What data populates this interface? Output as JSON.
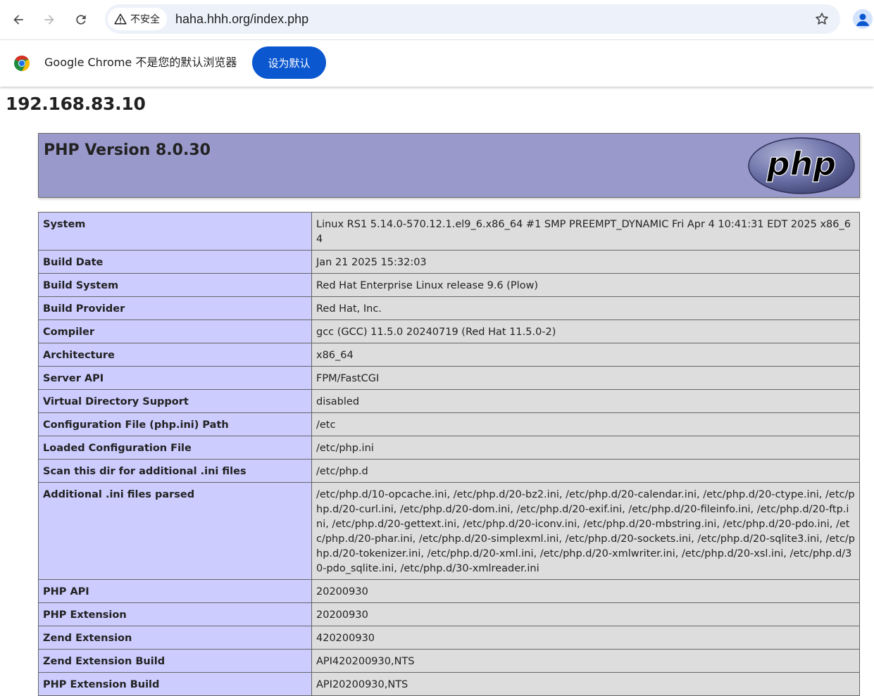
{
  "browser": {
    "security_label": "不安全",
    "url": "haha.hhh.org/index.php",
    "icons": {
      "back": "arrow-left-icon",
      "forward": "arrow-right-icon",
      "reload": "reload-icon",
      "security": "warning-triangle-icon",
      "bookmark": "star-icon",
      "profile": "person-icon"
    }
  },
  "infobar": {
    "message": "Google Chrome 不是您的默认浏览器",
    "button_label": "设为默认"
  },
  "page": {
    "host_heading": "192.168.83.10",
    "php_version": "PHP Version 8.0.30",
    "logo_text": "php",
    "rows": [
      {
        "key": "System",
        "value": "Linux RS1 5.14.0-570.12.1.el9_6.x86_64 #1 SMP PREEMPT_DYNAMIC Fri Apr 4 10:41:31 EDT 2025 x86_64"
      },
      {
        "key": "Build Date",
        "value": "Jan 21 2025 15:32:03"
      },
      {
        "key": "Build System",
        "value": "Red Hat Enterprise Linux release 9.6 (Plow)"
      },
      {
        "key": "Build Provider",
        "value": "Red Hat, Inc."
      },
      {
        "key": "Compiler",
        "value": "gcc (GCC) 11.5.0 20240719 (Red Hat 11.5.0-2)"
      },
      {
        "key": "Architecture",
        "value": "x86_64"
      },
      {
        "key": "Server API",
        "value": "FPM/FastCGI"
      },
      {
        "key": "Virtual Directory Support",
        "value": "disabled"
      },
      {
        "key": "Configuration File (php.ini) Path",
        "value": "/etc"
      },
      {
        "key": "Loaded Configuration File",
        "value": "/etc/php.ini"
      },
      {
        "key": "Scan this dir for additional .ini files",
        "value": "/etc/php.d"
      },
      {
        "key": "Additional .ini files parsed",
        "value": "/etc/php.d/10-opcache.ini, /etc/php.d/20-bz2.ini, /etc/php.d/20-calendar.ini, /etc/php.d/20-ctype.ini, /etc/php.d/20-curl.ini, /etc/php.d/20-dom.ini, /etc/php.d/20-exif.ini, /etc/php.d/20-fileinfo.ini, /etc/php.d/20-ftp.ini, /etc/php.d/20-gettext.ini, /etc/php.d/20-iconv.ini, /etc/php.d/20-mbstring.ini, /etc/php.d/20-pdo.ini, /etc/php.d/20-phar.ini, /etc/php.d/20-simplexml.ini, /etc/php.d/20-sockets.ini, /etc/php.d/20-sqlite3.ini, /etc/php.d/20-tokenizer.ini, /etc/php.d/20-xml.ini, /etc/php.d/20-xmlwriter.ini, /etc/php.d/20-xsl.ini, /etc/php.d/30-pdo_sqlite.ini, /etc/php.d/30-xmlreader.ini"
      },
      {
        "key": "PHP API",
        "value": "20200930"
      },
      {
        "key": "PHP Extension",
        "value": "20200930"
      },
      {
        "key": "Zend Extension",
        "value": "420200930"
      },
      {
        "key": "Zend Extension Build",
        "value": "API420200930,NTS"
      },
      {
        "key": "PHP Extension Build",
        "value": "API20200930,NTS"
      }
    ]
  },
  "colors": {
    "header_bg": "#9999cc",
    "key_cell_bg": "#ccccff",
    "value_cell_bg": "#dddddd",
    "infobar_button": "#0b57d0",
    "omnibox_bg": "#edf2fa"
  }
}
